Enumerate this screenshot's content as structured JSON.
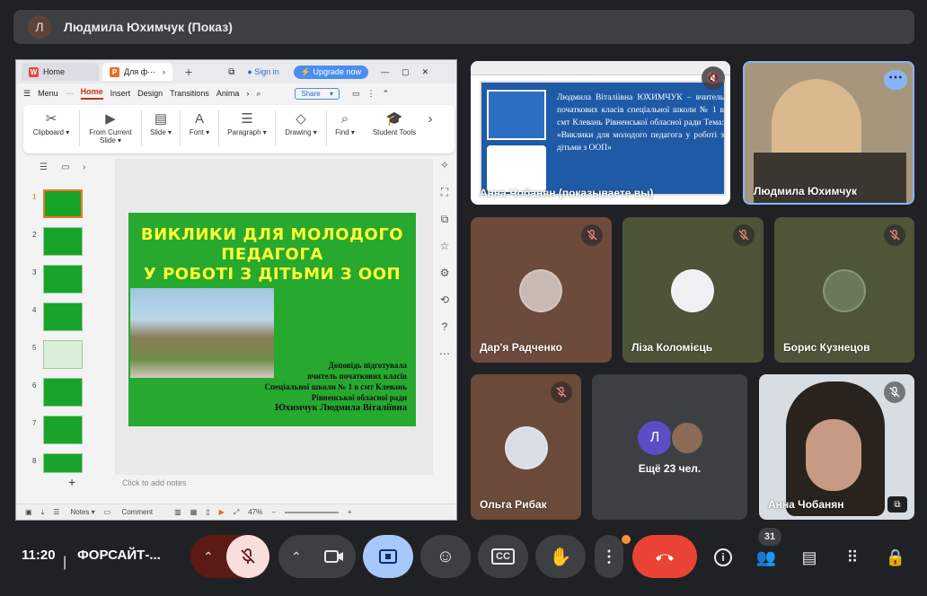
{
  "presenter_bar": {
    "initial": "Л",
    "title": "Людмила Юхимчук (Показ)"
  },
  "wps": {
    "tab_home": "Home",
    "tab_doc": "Для ф⋯",
    "sign_in": "Sign in",
    "upgrade": "Upgrade now",
    "menu_label": "Menu",
    "menus": [
      "Home",
      "Insert",
      "Design",
      "Transitions",
      "Anima"
    ],
    "share_label": "Share",
    "ribbon": [
      {
        "icon": "✂",
        "label": "Clipboard ▾"
      },
      {
        "icon": "▶",
        "label": "From Current Slide ▾"
      },
      {
        "icon": "▤",
        "label": "Slide ▾"
      },
      {
        "icon": "A",
        "label": "Font ▾"
      },
      {
        "icon": "☰",
        "label": "Paragraph ▾"
      },
      {
        "icon": "◇",
        "label": "Drawing ▾"
      },
      {
        "icon": "⌕",
        "label": "Find ▾"
      },
      {
        "icon": "🎓",
        "label": "Student Tools"
      }
    ],
    "slide_numbers": [
      "1",
      "2",
      "3",
      "4",
      "5",
      "6",
      "7",
      "8"
    ],
    "slide": {
      "title_line1": "ВИКЛИКИ ДЛЯ МОЛОДОГО",
      "title_line2": "ПЕДАГОГА",
      "title_line3": "У РОБОТІ З ДІТЬМИ З ООП",
      "body_line1": "Доповідь підготувала",
      "body_line2": "вчитель початкових класів",
      "body_line3": "Спеціальної школи № 1 в смт Клевань",
      "body_line4": "Рівненської обласної ради",
      "body_line5": "Юхимчук Людмила Віталіївна"
    },
    "notes_placeholder": "Click to add notes",
    "status": {
      "notes": "Notes",
      "comment": "Comment",
      "zoom": "47%"
    }
  },
  "presenting_tile": {
    "name": "Анна Чобанян (показываете вы)",
    "text": "Людмила Віталіївна ЮХИМЧУК – вчитель початкових класів спеціальної школи № 1 в смт Клевань Рівненської обласної ради Тема: «Виклики для молодого педагога у роботі з дітьми з ООП»"
  },
  "participants": [
    {
      "name": "Людмила Юхимчук",
      "muted": false
    },
    {
      "name": "Дар'я Радченко",
      "muted": true
    },
    {
      "name": "Ліза Коломієць",
      "muted": true
    },
    {
      "name": "Борис Кузнецов",
      "muted": true
    },
    {
      "name": "Ольга Рибак",
      "muted": true
    },
    {
      "name": "Анна Чобанян",
      "muted": true
    }
  ],
  "others_tile": {
    "initial": "Л",
    "label": "Ещё 23 чел."
  },
  "bottom_bar": {
    "time": "11:20",
    "meeting_title": "ФОРСАЙТ-...",
    "participant_count": "31"
  },
  "colors": {
    "accent_blue": "#8ab4f8",
    "end_call_red": "#ea4335",
    "mic_off_bg": "#f9dedc",
    "present_bg": "#a8c7fa"
  }
}
